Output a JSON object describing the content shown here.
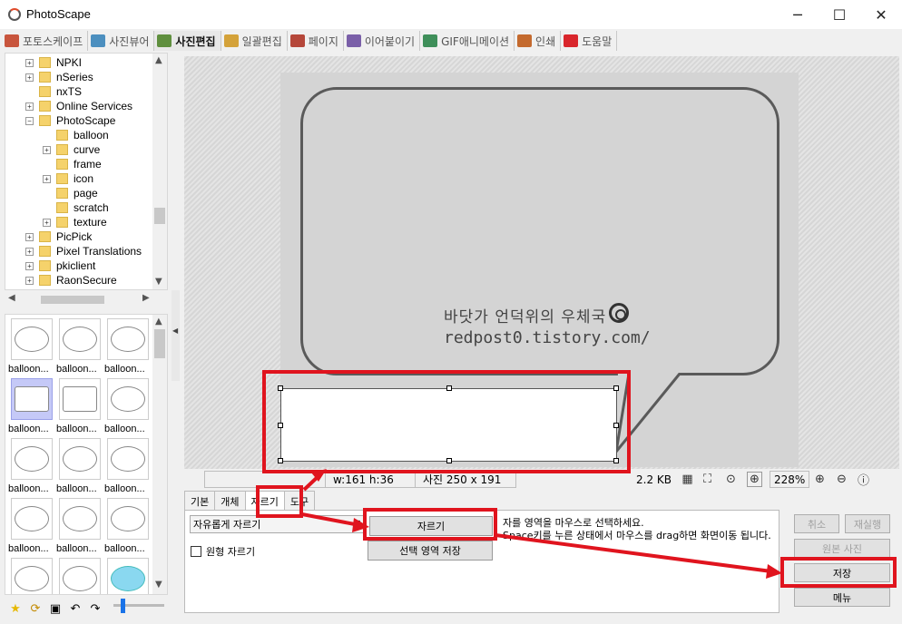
{
  "window": {
    "title": "PhotoScape",
    "minimize": "─",
    "maximize": "☐",
    "close": "✕"
  },
  "tabs": [
    {
      "label": "포토스케이프",
      "icon": "photoscape-home-icon",
      "color": "#c8553d"
    },
    {
      "label": "사진뷰어",
      "icon": "photo-viewer-icon",
      "color": "#4c8fbf"
    },
    {
      "label": "사진편집",
      "icon": "photo-editor-icon",
      "color": "#5f8f3e",
      "active": true
    },
    {
      "label": "일괄편집",
      "icon": "batch-editor-icon",
      "color": "#d4a23a"
    },
    {
      "label": "페이지",
      "icon": "page-icon",
      "color": "#b5473a"
    },
    {
      "label": "이어붙이기",
      "icon": "combine-icon",
      "color": "#7a5fa8"
    },
    {
      "label": "GIF애니메이션",
      "icon": "gif-animation-icon",
      "color": "#3f8f5a"
    },
    {
      "label": "인쇄",
      "icon": "print-icon",
      "color": "#c46a2e"
    },
    {
      "label": "도움말",
      "icon": "help-icon",
      "color": "#d9262c"
    }
  ],
  "tree": [
    {
      "label": "NPKI",
      "level": 1,
      "expander": "+"
    },
    {
      "label": "nSeries",
      "level": 1,
      "expander": "+"
    },
    {
      "label": "nxTS",
      "level": 1,
      "expander": ""
    },
    {
      "label": "Online Services",
      "level": 1,
      "expander": "+"
    },
    {
      "label": "PhotoScape",
      "level": 1,
      "expander": "−"
    },
    {
      "label": "balloon",
      "level": 2,
      "expander": ""
    },
    {
      "label": "curve",
      "level": 2,
      "expander": "+"
    },
    {
      "label": "frame",
      "level": 2,
      "expander": ""
    },
    {
      "label": "icon",
      "level": 2,
      "expander": "+"
    },
    {
      "label": "page",
      "level": 2,
      "expander": ""
    },
    {
      "label": "scratch",
      "level": 2,
      "expander": ""
    },
    {
      "label": "texture",
      "level": 2,
      "expander": "+"
    },
    {
      "label": "PicPick",
      "level": 1,
      "expander": "+"
    },
    {
      "label": "Pixel Translations",
      "level": 1,
      "expander": "+"
    },
    {
      "label": "pkiclient",
      "level": 1,
      "expander": "+"
    },
    {
      "label": "RaonSecure",
      "level": 1,
      "expander": "+"
    }
  ],
  "thumbnails": [
    {
      "label": "balloon..."
    },
    {
      "label": "balloon..."
    },
    {
      "label": "balloon..."
    },
    {
      "label": "balloon...",
      "selected": true
    },
    {
      "label": "balloon..."
    },
    {
      "label": "balloon..."
    },
    {
      "label": "balloon..."
    },
    {
      "label": "balloon..."
    },
    {
      "label": "balloon..."
    },
    {
      "label": "balloon..."
    },
    {
      "label": "balloon..."
    },
    {
      "label": "balloon..."
    },
    {
      "label": ""
    },
    {
      "label": ""
    },
    {
      "label": "",
      "blue": true
    }
  ],
  "watermark": {
    "line1": "바닷가 언덕위의 우체국",
    "line2": "redpost0.tistory.com/"
  },
  "status": {
    "selection": "w:161 h:36",
    "photo_size": "사진 250 x 191",
    "file_size": "2.2 KB",
    "zoom": "228%"
  },
  "bottom_tabs": [
    "기본",
    "개체",
    "자르기",
    "도구"
  ],
  "crop": {
    "mode": "자유롭게 자르기",
    "crop_button": "자르기",
    "save_selection_button": "선택 영역 저장",
    "circle_crop_label": "원형 자르기",
    "hint_line1": "자를 영역을 마우스로 선택하세요.",
    "hint_line2": "Space키를 누른 상태에서 마우스를 drag하면 화면이동 됩니다."
  },
  "right_buttons": {
    "cancel": "취소",
    "redo": "재실행",
    "original": "원본 사진",
    "save": "저장",
    "menu": "메뉴"
  },
  "highlight_color": "#e0141e"
}
